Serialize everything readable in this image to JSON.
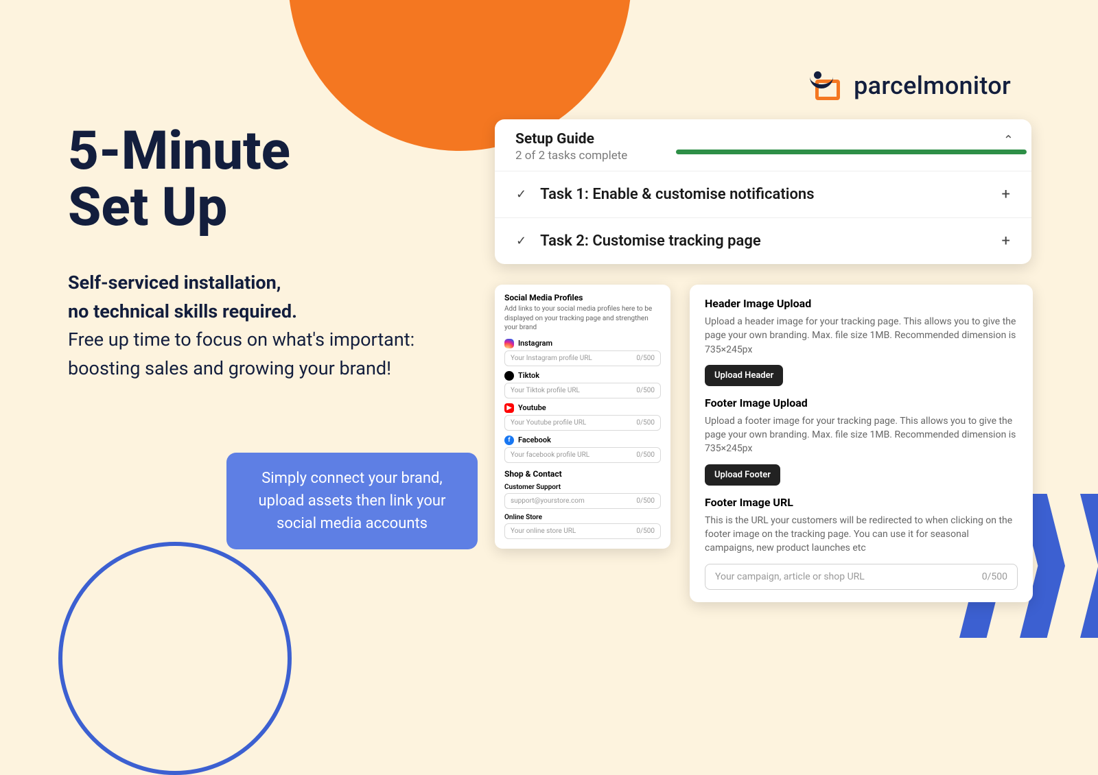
{
  "brand": {
    "name": "parcelmonitor"
  },
  "hero": {
    "title_line1": "5-Minute",
    "title_line2": "Set Up",
    "sub_bold_line1": "Self-serviced installation,",
    "sub_bold_line2": "no technical skills required.",
    "sub_rest": "Free up time to focus on what's important: boosting sales and growing your brand!"
  },
  "callout": "Simply connect your brand, upload assets then link your social media accounts",
  "setup": {
    "title": "Setup Guide",
    "progress_text": "2 of 2 tasks complete",
    "tasks": [
      {
        "title": "Task 1: Enable & customise notifications"
      },
      {
        "title": "Task 2: Customise tracking page"
      }
    ]
  },
  "social": {
    "title": "Social Media Profiles",
    "desc": "Add links to your social media profiles here to be displayed on your tracking page and strengthen your brand",
    "counter": "0/500",
    "items": [
      {
        "name": "Instagram",
        "placeholder": "Your Instagram profile URL",
        "cls": "ig"
      },
      {
        "name": "Tiktok",
        "placeholder": "Your Tiktok profile URL",
        "cls": "tt"
      },
      {
        "name": "Youtube",
        "placeholder": "Your Youtube profile URL",
        "cls": "yt"
      },
      {
        "name": "Facebook",
        "placeholder": "Your facebook profile URL",
        "cls": "fb"
      }
    ],
    "shop_contact_title": "Shop & Contact",
    "support_label": "Customer Support",
    "support_placeholder": "support@yourstore.com",
    "store_label": "Online Store",
    "store_placeholder": "Your online store URL"
  },
  "upload": {
    "header_title": "Header Image Upload",
    "header_desc": "Upload a header image for your tracking page. This allows you to give the page your own branding. Max. file size 1MB. Recommended dimension is 735×245px",
    "header_btn": "Upload Header",
    "footer_title": "Footer Image Upload",
    "footer_desc": "Upload a footer image for your tracking page. This allows you to give the page your own branding. Max. file size 1MB. Recommended dimension is 735×245px",
    "footer_btn": "Upload Footer",
    "url_title": "Footer Image URL",
    "url_desc": "This is the URL your customers will be redirected to when clicking on the footer image on the tracking page. You can use it for seasonal campaigns, new product launches etc",
    "url_placeholder": "Your campaign, article or shop URL",
    "url_counter": "0/500"
  }
}
